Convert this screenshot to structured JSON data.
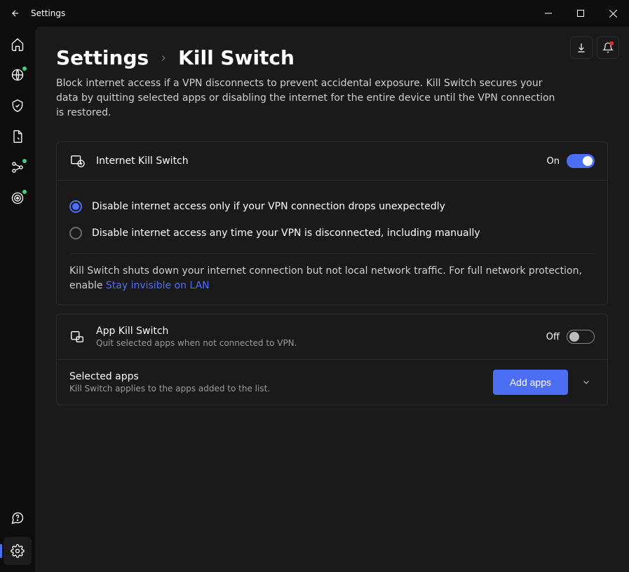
{
  "window": {
    "title": "Settings"
  },
  "breadcrumb": {
    "root": "Settings",
    "leaf": "Kill Switch"
  },
  "description": "Block internet access if a VPN disconnects to prevent accidental exposure. Kill Switch secures your data by quitting selected apps or disabling the internet for the entire device until the VPN connection is restored.",
  "internet_ks": {
    "title": "Internet Kill Switch",
    "state_label": "On",
    "enabled": true,
    "options": [
      {
        "label": "Disable internet access only if your VPN connection drops unexpectedly",
        "selected": true
      },
      {
        "label": "Disable internet access any time your VPN is disconnected, including manually",
        "selected": false
      }
    ],
    "note_prefix": "Kill Switch shuts down your internet connection but not local network traffic. For full network protection, enable ",
    "note_link": "Stay invisible on LAN"
  },
  "app_ks": {
    "title": "App Kill Switch",
    "subtitle": "Quit selected apps when not connected to VPN.",
    "state_label": "Off",
    "enabled": false
  },
  "selected_apps": {
    "title": "Selected apps",
    "subtitle": "Kill Switch applies to the apps added to the list.",
    "button": "Add apps"
  },
  "sidebar": {
    "items": [
      {
        "name": "home-icon"
      },
      {
        "name": "globe-icon"
      },
      {
        "name": "shield-icon"
      },
      {
        "name": "file-icon"
      },
      {
        "name": "network-icon"
      },
      {
        "name": "target-icon"
      }
    ]
  }
}
